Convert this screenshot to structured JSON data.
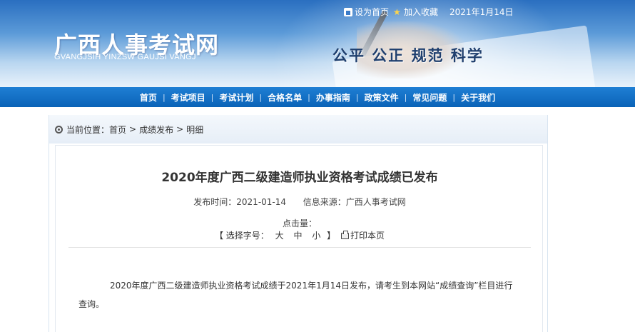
{
  "header": {
    "top_links": {
      "set_home": "设为首页",
      "add_favorite": "加入收藏",
      "date": "2021年1月14日"
    },
    "logo_cn": "广西人事考试网",
    "logo_en": "GVANGJSIH YINZSW GAUJSI VANGJ",
    "slogan": "公平 公正 规范 科学"
  },
  "nav": {
    "items": [
      "首页",
      "考试项目",
      "考试计划",
      "合格名单",
      "办事指南",
      "政策文件",
      "常见问题",
      "关于我们"
    ],
    "separator": "|"
  },
  "breadcrumb": {
    "prefix": "当前位置：",
    "items": [
      "首页",
      "成绩发布",
      "明细"
    ],
    "separator": ">"
  },
  "article": {
    "title": "2020年度广西二级建造师执业资格考试成绩已发布",
    "publish_label": "发布时间：",
    "publish_date": "2021-01-14",
    "source_label": "信息来源：",
    "source": "广西人事考试网",
    "clicks_label": "点击量：",
    "font_select_open": "【 选择字号：",
    "font_large": "大",
    "font_medium": "中",
    "font_small": "小",
    "font_select_close": "】",
    "print_label": "打印本页",
    "body": "2020年度广西二级建造师执业资格考试成绩于2021年1月14日发布，请考生到本网站“成绩查询”栏目进行查询。"
  },
  "icons": {
    "home": "home-icon",
    "favorite": "star-icon",
    "location": "location-dot-icon",
    "print": "printer-icon"
  },
  "colors": {
    "nav_bar": "#0a63b7",
    "banner_top": "#2a6fc0",
    "slogan": "#1f3f6e"
  }
}
